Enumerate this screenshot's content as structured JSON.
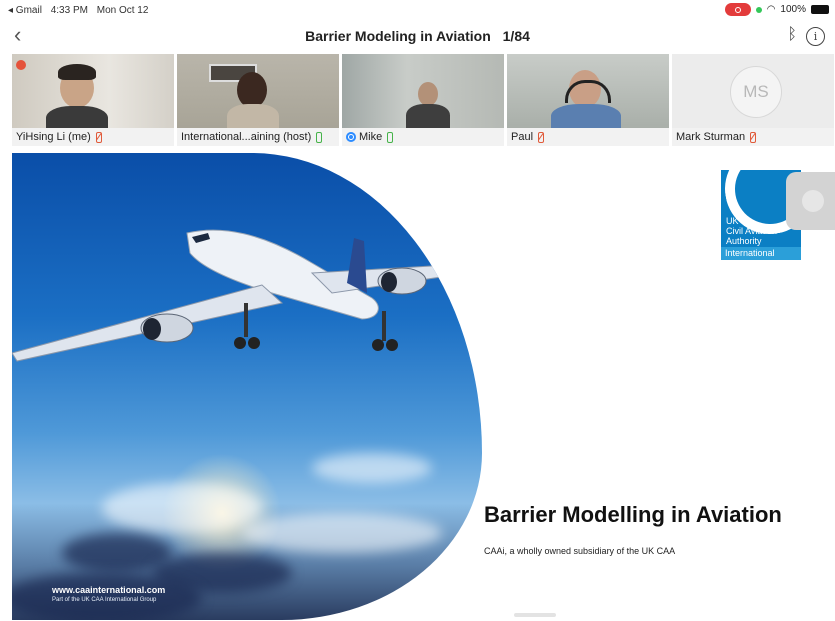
{
  "status_bar": {
    "back_app": "◂ Gmail",
    "time": "4:33 PM",
    "date": "Mon Oct 12",
    "battery": "100%"
  },
  "navbar": {
    "back_icon": "chevron-left-icon",
    "title": "Barrier Modeling in Aviation",
    "page_count": "1/84",
    "bluetooth_icon": "bluetooth-icon",
    "info_icon": "info-icon"
  },
  "participants": [
    {
      "name": "YiHsing Li (me)",
      "mic": "muted"
    },
    {
      "name": "International...aining (host)",
      "mic": "on"
    },
    {
      "name": "Mike",
      "mic": "on"
    },
    {
      "name": "Paul",
      "mic": "muted"
    },
    {
      "name": "Mark Sturman",
      "mic": "muted",
      "avatar_initials": "MS"
    }
  ],
  "slide": {
    "title": "Barrier Modelling in Aviation",
    "subtitle": "CAAi, a wholly owned subsidiary of the UK CAA",
    "url": "www.caainternational.com",
    "url_sub": "Part of the UK CAA International Group",
    "logo": {
      "line1": "UK",
      "line2": "Civil Aviation",
      "line3": "Authority",
      "line4": "International"
    }
  },
  "colors": {
    "brand_blue": "#0b7fc4",
    "muted_red": "#e15a3a",
    "mic_green": "#46b34a"
  }
}
